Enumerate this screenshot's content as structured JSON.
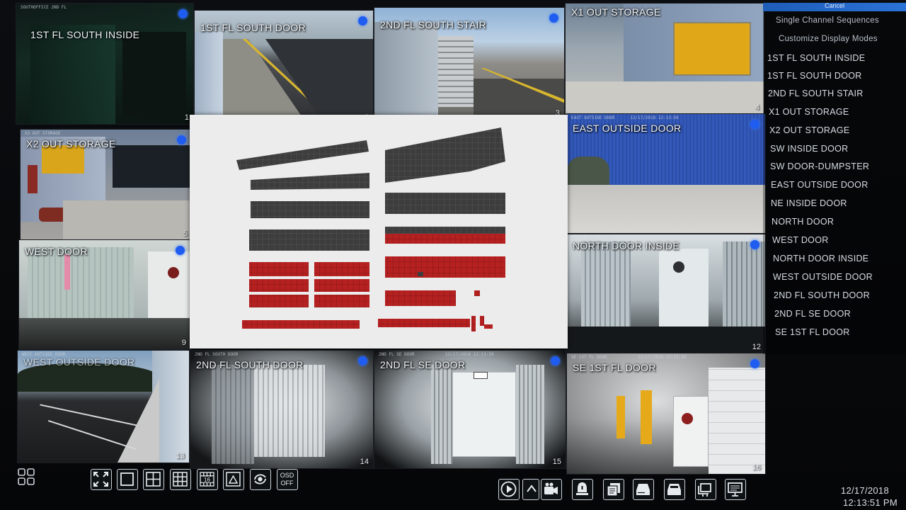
{
  "sidebar": {
    "top_label": "Cancel",
    "items": [
      "Single Channel Sequences",
      "Customize Display Modes",
      "1ST FL SOUTH INSIDE",
      "1ST FL SOUTH DOOR",
      "2ND FL SOUTH STAIR",
      "X1 OUT STORAGE",
      "X2 OUT STORAGE",
      "SW INSIDE DOOR",
      "SW DOOR-DUMPSTER",
      "EAST OUTSIDE DOOR",
      "NE INSIDE DOOR",
      "NORTH DOOR",
      "WEST DOOR",
      "NORTH DOOR INSIDE",
      "WEST OUTSIDE DOOR",
      "2ND FL SOUTH DOOR",
      "2ND FL SE DOOR",
      "SE 1ST FL DOOR"
    ]
  },
  "cameras": [
    {
      "title": "1ST FL SOUTH INSIDE",
      "number": "1"
    },
    {
      "title": "1ST FL SOUTH DOOR",
      "number": "2"
    },
    {
      "title": "2ND FL SOUTH STAIR",
      "number": "3"
    },
    {
      "title": "X1 OUT STORAGE",
      "number": "4"
    },
    {
      "title": "X2 OUT STORAGE",
      "number": "5"
    },
    {
      "title": "EAST OUTSIDE DOOR",
      "number": ""
    },
    {
      "title": "WEST DOOR",
      "number": "9"
    },
    {
      "title": "NORTH DOOR INSIDE",
      "number": "12"
    },
    {
      "title": "WEST OUTSIDE DOOR",
      "number": "13"
    },
    {
      "title": "2ND FL SOUTH DOOR",
      "number": "14"
    },
    {
      "title": "2ND FL SE DOOR",
      "number": "15"
    },
    {
      "title": "SE 1ST FL DOOR",
      "number": "16"
    }
  ],
  "camera_info": {
    "overlay_date": "12/17/2018",
    "overlay_time": "12:13:50"
  },
  "toolbar": {
    "split16_label": "16",
    "osd_label_line1": "OSD",
    "osd_label_line2": "OFF"
  },
  "clock": {
    "date": "12/17/2018",
    "time": "12:13:51 PM"
  },
  "colors": {
    "marker_blue": "#1f5cf0",
    "dark_block": "#3d3d3d",
    "red_block": "#b52020"
  },
  "icons": [
    "menu-icon",
    "fullscreen-icon",
    "single-view-icon",
    "quad-view-icon",
    "nine-view-icon",
    "sixteen-view-icon",
    "pip-view-icon",
    "sequence-icon",
    "osd-icon",
    "playback-icon",
    "expand-up-icon",
    "record-icon",
    "alarm-icon",
    "search-icon",
    "hdd-icon",
    "backup-icon",
    "network-icon",
    "monitor-icon"
  ]
}
